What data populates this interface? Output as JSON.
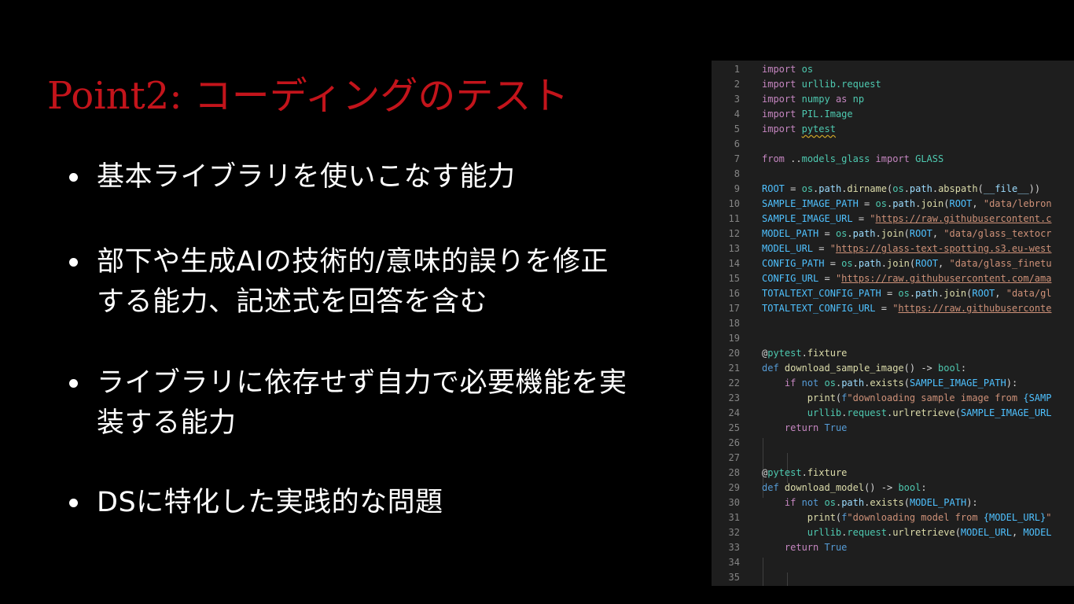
{
  "slide": {
    "title": "Point2: コーディングのテスト",
    "title_color": "#c3141b",
    "bullets": [
      {
        "lines": [
          "基本ライブラリを使いこなす能力"
        ]
      },
      {
        "lines": [
          "部下や生成AIの技術的/意味的誤りを修正",
          "する能力、記述式を回答を含む"
        ]
      },
      {
        "lines": [
          "ライブラリに依存せず自力で必要機能を実",
          "装する能力"
        ]
      },
      {
        "lines": [
          "DSに特化した実践的な問題"
        ]
      }
    ]
  },
  "code_panel": {
    "background": "#1e1e1e",
    "colors": {
      "keyword": "#c586c0",
      "control": "#569cd6",
      "module": "#4ec9b0",
      "function": "#dcdcaa",
      "variable": "#9cdcfe",
      "constant": "#4fc1ff",
      "string": "#ce9178",
      "plain": "#d4d4d4",
      "decorator": "#dcdcaa"
    },
    "lines": [
      {
        "n": "1",
        "tokens": [
          [
            "import",
            "keyword"
          ],
          [
            " ",
            "plain"
          ],
          [
            "os",
            "module"
          ]
        ]
      },
      {
        "n": "2",
        "tokens": [
          [
            "import",
            "keyword"
          ],
          [
            " ",
            "plain"
          ],
          [
            "urllib.request",
            "module"
          ]
        ]
      },
      {
        "n": "3",
        "tokens": [
          [
            "import",
            "keyword"
          ],
          [
            " ",
            "plain"
          ],
          [
            "numpy",
            "module"
          ],
          [
            " as ",
            "keyword"
          ],
          [
            "np",
            "module"
          ]
        ]
      },
      {
        "n": "4",
        "tokens": [
          [
            "import",
            "keyword"
          ],
          [
            " ",
            "plain"
          ],
          [
            "PIL.Image",
            "module"
          ]
        ]
      },
      {
        "n": "5",
        "tokens": [
          [
            "import",
            "keyword"
          ],
          [
            " ",
            "plain"
          ],
          [
            "pytest",
            "module",
            "squiggle"
          ]
        ]
      },
      {
        "n": "6",
        "tokens": []
      },
      {
        "n": "7",
        "tokens": [
          [
            "from",
            "keyword"
          ],
          [
            " ..",
            "plain"
          ],
          [
            "models_glass",
            "module"
          ],
          [
            " import ",
            "keyword"
          ],
          [
            "GLASS",
            "module"
          ]
        ]
      },
      {
        "n": "8",
        "tokens": []
      },
      {
        "n": "9",
        "tokens": [
          [
            "ROOT",
            "constant"
          ],
          [
            " = ",
            "plain"
          ],
          [
            "os",
            "module"
          ],
          [
            ".",
            "plain"
          ],
          [
            "path",
            "variable"
          ],
          [
            ".",
            "plain"
          ],
          [
            "dirname",
            "function"
          ],
          [
            "(",
            "plain"
          ],
          [
            "os",
            "module"
          ],
          [
            ".",
            "plain"
          ],
          [
            "path",
            "variable"
          ],
          [
            ".",
            "plain"
          ],
          [
            "abspath",
            "function"
          ],
          [
            "(",
            "plain"
          ],
          [
            "__file__",
            "variable"
          ],
          [
            "))",
            "plain"
          ]
        ]
      },
      {
        "n": "10",
        "tokens": [
          [
            "SAMPLE_IMAGE_PATH",
            "constant"
          ],
          [
            " = ",
            "plain"
          ],
          [
            "os",
            "module"
          ],
          [
            ".",
            "plain"
          ],
          [
            "path",
            "variable"
          ],
          [
            ".",
            "plain"
          ],
          [
            "join",
            "function"
          ],
          [
            "(",
            "plain"
          ],
          [
            "ROOT",
            "constant"
          ],
          [
            ", ",
            "plain"
          ],
          [
            "\"data/lebron",
            "string"
          ]
        ]
      },
      {
        "n": "11",
        "tokens": [
          [
            "SAMPLE_IMAGE_URL",
            "constant"
          ],
          [
            " = ",
            "plain"
          ],
          [
            "\"",
            "string"
          ],
          [
            "https://raw.githubusercontent.c",
            "string",
            "underline"
          ]
        ]
      },
      {
        "n": "12",
        "tokens": [
          [
            "MODEL_PATH",
            "constant"
          ],
          [
            " = ",
            "plain"
          ],
          [
            "os",
            "module"
          ],
          [
            ".",
            "plain"
          ],
          [
            "path",
            "variable"
          ],
          [
            ".",
            "plain"
          ],
          [
            "join",
            "function"
          ],
          [
            "(",
            "plain"
          ],
          [
            "ROOT",
            "constant"
          ],
          [
            ", ",
            "plain"
          ],
          [
            "\"data/glass_textocr",
            "string"
          ]
        ]
      },
      {
        "n": "13",
        "tokens": [
          [
            "MODEL_URL",
            "constant"
          ],
          [
            " = ",
            "plain"
          ],
          [
            "\"",
            "string"
          ],
          [
            "https://glass-text-spotting.s3.eu-west",
            "string",
            "underline"
          ]
        ]
      },
      {
        "n": "14",
        "tokens": [
          [
            "CONFIG_PATH",
            "constant"
          ],
          [
            " = ",
            "plain"
          ],
          [
            "os",
            "module"
          ],
          [
            ".",
            "plain"
          ],
          [
            "path",
            "variable"
          ],
          [
            ".",
            "plain"
          ],
          [
            "join",
            "function"
          ],
          [
            "(",
            "plain"
          ],
          [
            "ROOT",
            "constant"
          ],
          [
            ", ",
            "plain"
          ],
          [
            "\"data/glass_finetu",
            "string"
          ]
        ]
      },
      {
        "n": "15",
        "tokens": [
          [
            "CONFIG_URL",
            "constant"
          ],
          [
            " = ",
            "plain"
          ],
          [
            "\"",
            "string"
          ],
          [
            "https://raw.githubusercontent.com/ama",
            "string",
            "underline"
          ]
        ]
      },
      {
        "n": "16",
        "tokens": [
          [
            "TOTALTEXT_CONFIG_PATH",
            "constant"
          ],
          [
            " = ",
            "plain"
          ],
          [
            "os",
            "module"
          ],
          [
            ".",
            "plain"
          ],
          [
            "path",
            "variable"
          ],
          [
            ".",
            "plain"
          ],
          [
            "join",
            "function"
          ],
          [
            "(",
            "plain"
          ],
          [
            "ROOT",
            "constant"
          ],
          [
            ", ",
            "plain"
          ],
          [
            "\"data/gl",
            "string"
          ]
        ]
      },
      {
        "n": "17",
        "tokens": [
          [
            "TOTALTEXT_CONFIG_URL",
            "constant"
          ],
          [
            " = ",
            "plain"
          ],
          [
            "\"",
            "string"
          ],
          [
            "https://raw.githubuserconte",
            "string",
            "underline"
          ]
        ]
      },
      {
        "n": "18",
        "tokens": []
      },
      {
        "n": "19",
        "tokens": []
      },
      {
        "n": "20",
        "tokens": [
          [
            "@",
            "plain"
          ],
          [
            "pytest",
            "module"
          ],
          [
            ".",
            "plain"
          ],
          [
            "fixture",
            "decorator"
          ]
        ]
      },
      {
        "n": "21",
        "tokens": [
          [
            "def",
            "control"
          ],
          [
            " ",
            "plain"
          ],
          [
            "download_sample_image",
            "function"
          ],
          [
            "() -> ",
            "plain"
          ],
          [
            "bool",
            "module"
          ],
          [
            ":",
            "plain"
          ]
        ]
      },
      {
        "n": "22",
        "tokens": [
          [
            "    ",
            "plain"
          ],
          [
            "if",
            "keyword"
          ],
          [
            " ",
            "plain"
          ],
          [
            "not",
            "control"
          ],
          [
            " ",
            "plain"
          ],
          [
            "os",
            "module"
          ],
          [
            ".",
            "plain"
          ],
          [
            "path",
            "variable"
          ],
          [
            ".",
            "plain"
          ],
          [
            "exists",
            "function"
          ],
          [
            "(",
            "plain"
          ],
          [
            "SAMPLE_IMAGE_PATH",
            "constant"
          ],
          [
            "):",
            "plain"
          ]
        ]
      },
      {
        "n": "23",
        "tokens": [
          [
            "        ",
            "plain"
          ],
          [
            "print",
            "function"
          ],
          [
            "(",
            "plain"
          ],
          [
            "f",
            "control"
          ],
          [
            "\"downloading sample image from ",
            "string"
          ],
          [
            "{SAMP",
            "constant"
          ]
        ]
      },
      {
        "n": "24",
        "tokens": [
          [
            "        ",
            "plain"
          ],
          [
            "urllib",
            "module"
          ],
          [
            ".",
            "plain"
          ],
          [
            "request",
            "module"
          ],
          [
            ".",
            "plain"
          ],
          [
            "urlretrieve",
            "function"
          ],
          [
            "(",
            "plain"
          ],
          [
            "SAMPLE_IMAGE_URL",
            "constant"
          ]
        ]
      },
      {
        "n": "25",
        "tokens": [
          [
            "    ",
            "plain"
          ],
          [
            "return",
            "keyword"
          ],
          [
            " ",
            "plain"
          ],
          [
            "True",
            "control"
          ]
        ]
      },
      {
        "n": "26",
        "tokens": []
      },
      {
        "n": "27",
        "tokens": []
      },
      {
        "n": "28",
        "tokens": [
          [
            "@",
            "plain"
          ],
          [
            "pytest",
            "module"
          ],
          [
            ".",
            "plain"
          ],
          [
            "fixture",
            "decorator"
          ]
        ]
      },
      {
        "n": "29",
        "tokens": [
          [
            "def",
            "control"
          ],
          [
            " ",
            "plain"
          ],
          [
            "download_model",
            "function"
          ],
          [
            "() -> ",
            "plain"
          ],
          [
            "bool",
            "module"
          ],
          [
            ":",
            "plain"
          ]
        ]
      },
      {
        "n": "30",
        "tokens": [
          [
            "    ",
            "plain"
          ],
          [
            "if",
            "keyword"
          ],
          [
            " ",
            "plain"
          ],
          [
            "not",
            "control"
          ],
          [
            " ",
            "plain"
          ],
          [
            "os",
            "module"
          ],
          [
            ".",
            "plain"
          ],
          [
            "path",
            "variable"
          ],
          [
            ".",
            "plain"
          ],
          [
            "exists",
            "function"
          ],
          [
            "(",
            "plain"
          ],
          [
            "MODEL_PATH",
            "constant"
          ],
          [
            "):",
            "plain"
          ]
        ]
      },
      {
        "n": "31",
        "tokens": [
          [
            "        ",
            "plain"
          ],
          [
            "print",
            "function"
          ],
          [
            "(",
            "plain"
          ],
          [
            "f",
            "control"
          ],
          [
            "\"downloading model from ",
            "string"
          ],
          [
            "{MODEL_URL}",
            "constant"
          ],
          [
            "\"",
            "string"
          ]
        ]
      },
      {
        "n": "32",
        "tokens": [
          [
            "        ",
            "plain"
          ],
          [
            "urllib",
            "module"
          ],
          [
            ".",
            "plain"
          ],
          [
            "request",
            "module"
          ],
          [
            ".",
            "plain"
          ],
          [
            "urlretrieve",
            "function"
          ],
          [
            "(",
            "plain"
          ],
          [
            "MODEL_URL",
            "constant"
          ],
          [
            ", ",
            "plain"
          ],
          [
            "MODEL",
            "constant"
          ]
        ]
      },
      {
        "n": "33",
        "tokens": [
          [
            "    ",
            "plain"
          ],
          [
            "return",
            "keyword"
          ],
          [
            " ",
            "plain"
          ],
          [
            "True",
            "control"
          ]
        ]
      },
      {
        "n": "34",
        "tokens": []
      },
      {
        "n": "35",
        "tokens": []
      }
    ]
  }
}
